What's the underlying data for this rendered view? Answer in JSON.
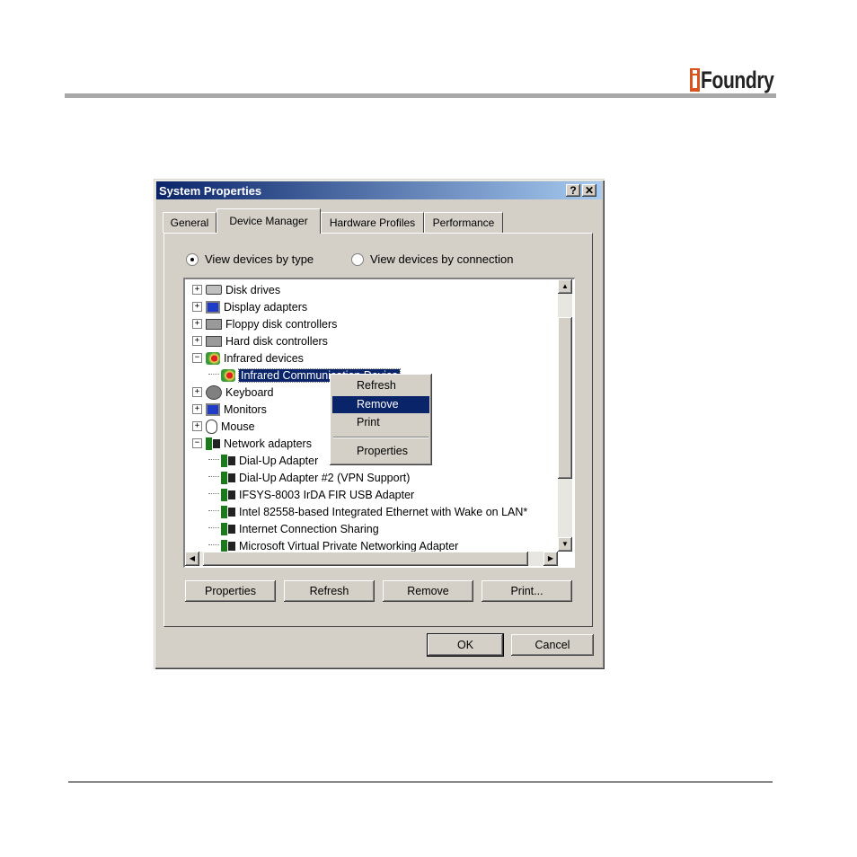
{
  "logo": {
    "text": "Foundry",
    "brand_color": "#d9531e"
  },
  "window": {
    "title": "System Properties",
    "help_label": "?",
    "close_label": "✕"
  },
  "tabs": [
    {
      "label": "General"
    },
    {
      "label": "Device Manager"
    },
    {
      "label": "Hardware Profiles"
    },
    {
      "label": "Performance"
    }
  ],
  "view": {
    "by_type_label": "View devices by type",
    "by_connection_label": "View devices by connection",
    "selected": "by_type"
  },
  "tree": {
    "items": [
      {
        "label": "Disk drives",
        "toggle": "+"
      },
      {
        "label": "Display adapters",
        "toggle": "+"
      },
      {
        "label": "Floppy disk controllers",
        "toggle": "+"
      },
      {
        "label": "Hard disk controllers",
        "toggle": "+"
      },
      {
        "label": "Infrared devices",
        "toggle": "−"
      },
      {
        "label": "Infrared Communication Device"
      },
      {
        "label": "Keyboard",
        "toggle": "+"
      },
      {
        "label": "Monitors",
        "toggle": "+"
      },
      {
        "label": "Mouse",
        "toggle": "+"
      },
      {
        "label": "Network adapters",
        "toggle": "−"
      },
      {
        "label": "Dial-Up Adapter"
      },
      {
        "label": "Dial-Up Adapter #2 (VPN Support)"
      },
      {
        "label": "IFSYS-8003 IrDA FIR USB Adapter"
      },
      {
        "label": "Intel 82558-based Integrated Ethernet with Wake on LAN*"
      },
      {
        "label": "Internet Connection Sharing"
      },
      {
        "label": "Microsoft Virtual Private Networking Adapter"
      }
    ]
  },
  "context_menu": {
    "items": [
      "Refresh",
      "Remove",
      "Print",
      "Properties"
    ],
    "highlighted": "Remove"
  },
  "panel_buttons": {
    "properties": "Properties",
    "refresh": "Refresh",
    "remove": "Remove",
    "print": "Print..."
  },
  "dialog_buttons": {
    "ok": "OK",
    "cancel": "Cancel"
  }
}
